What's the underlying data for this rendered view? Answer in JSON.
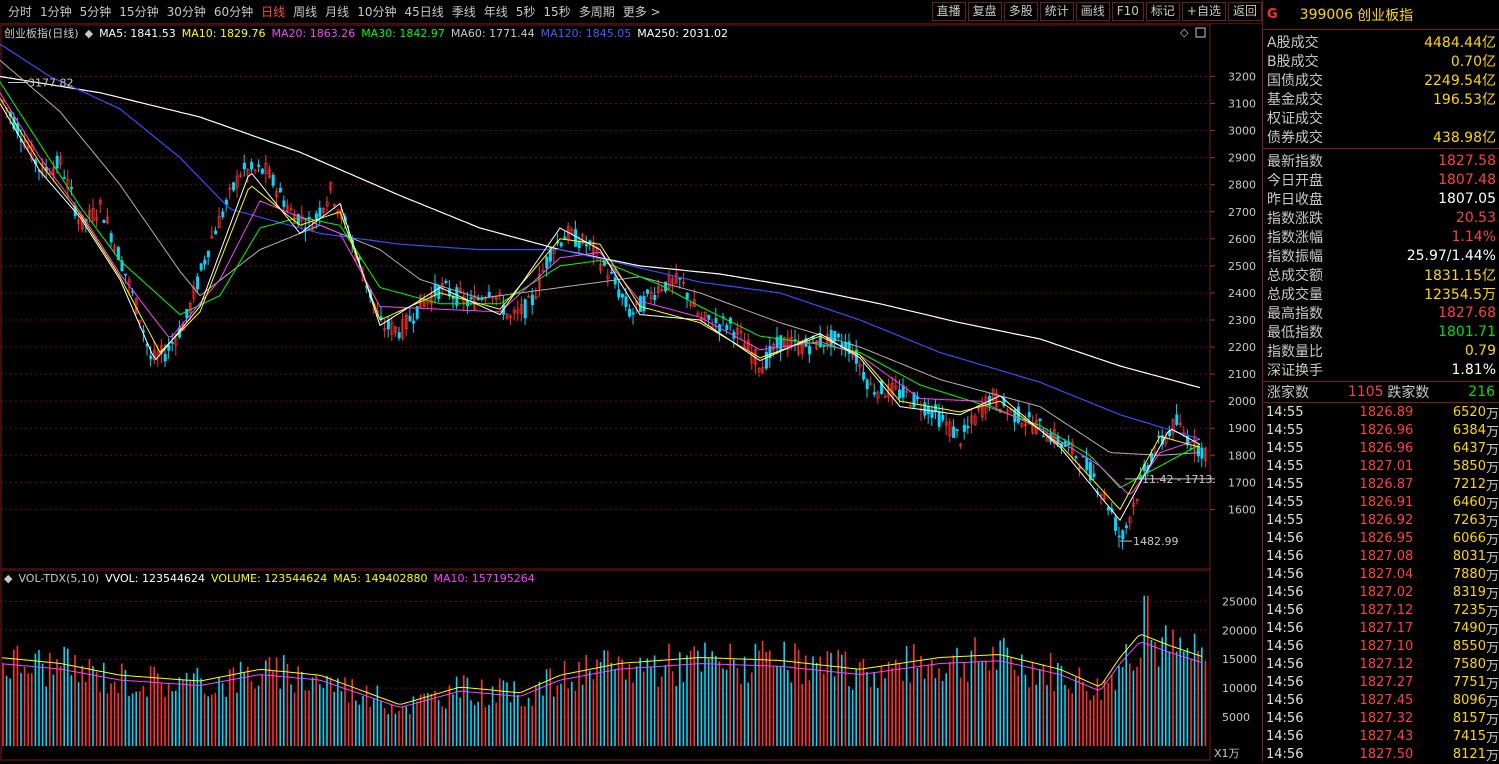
{
  "toolbar": {
    "periods": [
      "分时",
      "1分钟",
      "5分钟",
      "15分钟",
      "30分钟",
      "60分钟",
      "日线",
      "周线",
      "月线",
      "10分钟",
      "45日线",
      "季线",
      "年线",
      "5秒",
      "15秒",
      "多周期",
      "更多 >"
    ],
    "active_period": "日线",
    "tools": [
      "直播",
      "复盘",
      "多股",
      "统计",
      "画线",
      "F10",
      "标记",
      "+自选",
      "返回"
    ]
  },
  "main": {
    "title": "创业板指(日线)",
    "ma": [
      {
        "label": "MA5: 1841.53",
        "color": "#ffffff"
      },
      {
        "label": "MA10: 1829.76",
        "color": "#ffff00"
      },
      {
        "label": "MA20: 1863.26",
        "color": "#ff40ff"
      },
      {
        "label": "MA30: 1842.97",
        "color": "#00ff00"
      },
      {
        "label": "MA60: 1771.44",
        "color": "#c8c8c8"
      },
      {
        "label": "MA120: 1845.05",
        "color": "#4060ff"
      },
      {
        "label": "MA250: 2031.02",
        "color": "#ffffff"
      }
    ],
    "y_labels": [
      "3200",
      "3100",
      "3000",
      "2900",
      "2800",
      "2700",
      "2600",
      "2500",
      "2400",
      "2300",
      "2200",
      "2100",
      "2000",
      "1900",
      "1800",
      "1700",
      "1600"
    ],
    "annot_high": "3177.82",
    "annot_low": "1482.99",
    "annot_range": "11.42 - 1713."
  },
  "volume": {
    "title": "VOL-TDX(5,10)",
    "items": [
      {
        "label": "VVOL: 123544624",
        "color": "#ffffff"
      },
      {
        "label": "VOLUME: 123544624",
        "color": "#ffff00"
      },
      {
        "label": "MA5: 149402880",
        "color": "#ffff00"
      },
      {
        "label": "MA10: 157195264",
        "color": "#ff40ff"
      }
    ],
    "y_labels": [
      "25000",
      "20000",
      "15000",
      "10000",
      "5000"
    ],
    "unit": "X1万"
  },
  "panel": {
    "flag": "G",
    "code": "399006",
    "name": "创业板指",
    "turnover": [
      {
        "l": "A股成交",
        "v": "4484.44",
        "u": "亿"
      },
      {
        "l": "B股成交",
        "v": "0.70",
        "u": "亿"
      },
      {
        "l": "国债成交",
        "v": "2249.54",
        "u": "亿"
      },
      {
        "l": "基金成交",
        "v": "196.53",
        "u": "亿"
      },
      {
        "l": "权证成交",
        "v": "",
        "u": ""
      },
      {
        "l": "债券成交",
        "v": "438.98",
        "u": "亿"
      }
    ],
    "stats": [
      {
        "l": "最新指数",
        "v": "1827.58",
        "c": "rd"
      },
      {
        "l": "今日开盘",
        "v": "1807.48",
        "c": "rd"
      },
      {
        "l": "昨日收盘",
        "v": "1807.05",
        "c": "wh"
      },
      {
        "l": "指数涨跌",
        "v": "20.53",
        "c": "rd"
      },
      {
        "l": "指数涨幅",
        "v": "1.14%",
        "c": "rd"
      },
      {
        "l": "指数振幅",
        "v": "25.97/1.44%",
        "c": "wh"
      },
      {
        "l": "总成交额",
        "v": "1831.15亿",
        "c": "yl"
      },
      {
        "l": "总成交量",
        "v": "12354.5万",
        "c": "yl"
      },
      {
        "l": "最高指数",
        "v": "1827.68",
        "c": "rd"
      },
      {
        "l": "最低指数",
        "v": "1801.71",
        "c": "gr"
      },
      {
        "l": "指数量比",
        "v": "0.79",
        "c": "yl"
      },
      {
        "l": "深证换手",
        "v": "1.81%",
        "c": "wh"
      }
    ],
    "adv_label": "涨家数",
    "adv": "1105",
    "dec_label": "跌家数",
    "dec": "216",
    "ticks": [
      {
        "t": "14:55",
        "p": "1826.89",
        "v": "6520"
      },
      {
        "t": "14:55",
        "p": "1826.96",
        "v": "6384"
      },
      {
        "t": "14:55",
        "p": "1826.96",
        "v": "6437"
      },
      {
        "t": "14:55",
        "p": "1827.01",
        "v": "5850"
      },
      {
        "t": "14:55",
        "p": "1826.87",
        "v": "7212"
      },
      {
        "t": "14:55",
        "p": "1826.91",
        "v": "6460"
      },
      {
        "t": "14:55",
        "p": "1826.92",
        "v": "7263"
      },
      {
        "t": "14:56",
        "p": "1826.95",
        "v": "6066"
      },
      {
        "t": "14:56",
        "p": "1827.08",
        "v": "8031"
      },
      {
        "t": "14:56",
        "p": "1827.04",
        "v": "7880"
      },
      {
        "t": "14:56",
        "p": "1827.02",
        "v": "8319"
      },
      {
        "t": "14:56",
        "p": "1827.12",
        "v": "7235"
      },
      {
        "t": "14:56",
        "p": "1827.17",
        "v": "7490"
      },
      {
        "t": "14:56",
        "p": "1827.10",
        "v": "8550"
      },
      {
        "t": "14:56",
        "p": "1827.12",
        "v": "7580"
      },
      {
        "t": "14:56",
        "p": "1827.27",
        "v": "7751"
      },
      {
        "t": "14:56",
        "p": "1827.45",
        "v": "8096"
      },
      {
        "t": "14:56",
        "p": "1827.32",
        "v": "8157"
      },
      {
        "t": "14:56",
        "p": "1827.43",
        "v": "7415"
      },
      {
        "t": "14:56",
        "p": "1827.50",
        "v": "8121"
      }
    ],
    "tick_unit": "万"
  },
  "chart_data": {
    "type": "candlestick",
    "ylim": [
      1450,
      3320
    ],
    "ma_keypoints": {
      "MA250": [
        [
          0,
          3200
        ],
        [
          100,
          3140
        ],
        [
          200,
          3050
        ],
        [
          300,
          2920
        ],
        [
          400,
          2760
        ],
        [
          480,
          2640
        ],
        [
          560,
          2560
        ],
        [
          640,
          2500
        ],
        [
          720,
          2470
        ],
        [
          800,
          2420
        ],
        [
          880,
          2360
        ],
        [
          960,
          2290
        ],
        [
          1040,
          2230
        ],
        [
          1120,
          2130
        ],
        [
          1200,
          2050
        ]
      ],
      "MA120": [
        [
          0,
          3320
        ],
        [
          50,
          3200
        ],
        [
          120,
          3080
        ],
        [
          180,
          2900
        ],
        [
          230,
          2710
        ],
        [
          270,
          2670
        ],
        [
          320,
          2620
        ],
        [
          400,
          2580
        ],
        [
          480,
          2560
        ],
        [
          560,
          2560
        ],
        [
          620,
          2510
        ],
        [
          700,
          2440
        ],
        [
          780,
          2400
        ],
        [
          860,
          2300
        ],
        [
          940,
          2180
        ],
        [
          1040,
          2070
        ],
        [
          1120,
          1950
        ],
        [
          1200,
          1860
        ]
      ],
      "MA60": [
        [
          0,
          3260
        ],
        [
          60,
          3070
        ],
        [
          120,
          2800
        ],
        [
          180,
          2480
        ],
        [
          200,
          2390
        ],
        [
          260,
          2560
        ],
        [
          320,
          2650
        ],
        [
          380,
          2560
        ],
        [
          420,
          2450
        ],
        [
          480,
          2380
        ],
        [
          560,
          2420
        ],
        [
          640,
          2460
        ],
        [
          700,
          2400
        ],
        [
          780,
          2290
        ],
        [
          860,
          2200
        ],
        [
          940,
          2080
        ],
        [
          1040,
          1980
        ],
        [
          1110,
          1810
        ],
        [
          1160,
          1800
        ],
        [
          1200,
          1810
        ]
      ],
      "MA30": [
        [
          0,
          3180
        ],
        [
          40,
          2950
        ],
        [
          80,
          2720
        ],
        [
          120,
          2520
        ],
        [
          180,
          2320
        ],
        [
          220,
          2390
        ],
        [
          260,
          2640
        ],
        [
          300,
          2680
        ],
        [
          340,
          2650
        ],
        [
          380,
          2420
        ],
        [
          440,
          2360
        ],
        [
          500,
          2360
        ],
        [
          560,
          2500
        ],
        [
          600,
          2520
        ],
        [
          660,
          2430
        ],
        [
          700,
          2350
        ],
        [
          760,
          2240
        ],
        [
          820,
          2210
        ],
        [
          860,
          2180
        ],
        [
          920,
          2060
        ],
        [
          980,
          1990
        ],
        [
          1040,
          1910
        ],
        [
          1090,
          1800
        ],
        [
          1120,
          1680
        ],
        [
          1160,
          1760
        ],
        [
          1200,
          1840
        ]
      ],
      "MA20": [
        [
          0,
          3140
        ],
        [
          40,
          2900
        ],
        [
          80,
          2700
        ],
        [
          120,
          2470
        ],
        [
          170,
          2230
        ],
        [
          220,
          2450
        ],
        [
          260,
          2740
        ],
        [
          300,
          2680
        ],
        [
          340,
          2620
        ],
        [
          380,
          2350
        ],
        [
          440,
          2340
        ],
        [
          500,
          2330
        ],
        [
          560,
          2530
        ],
        [
          600,
          2550
        ],
        [
          640,
          2370
        ],
        [
          700,
          2310
        ],
        [
          760,
          2190
        ],
        [
          820,
          2220
        ],
        [
          860,
          2170
        ],
        [
          920,
          2010
        ],
        [
          980,
          2000
        ],
        [
          1040,
          1900
        ],
        [
          1100,
          1760
        ],
        [
          1130,
          1650
        ],
        [
          1160,
          1810
        ],
        [
          1200,
          1860
        ]
      ],
      "MA10": [
        [
          0,
          3120
        ],
        [
          40,
          2880
        ],
        [
          80,
          2690
        ],
        [
          120,
          2460
        ],
        [
          160,
          2180
        ],
        [
          200,
          2330
        ],
        [
          250,
          2800
        ],
        [
          300,
          2650
        ],
        [
          340,
          2700
        ],
        [
          380,
          2300
        ],
        [
          440,
          2400
        ],
        [
          500,
          2340
        ],
        [
          560,
          2600
        ],
        [
          600,
          2580
        ],
        [
          640,
          2350
        ],
        [
          700,
          2290
        ],
        [
          760,
          2160
        ],
        [
          820,
          2240
        ],
        [
          860,
          2170
        ],
        [
          900,
          2000
        ],
        [
          960,
          1960
        ],
        [
          1000,
          2000
        ],
        [
          1060,
          1840
        ],
        [
          1120,
          1600
        ],
        [
          1160,
          1870
        ],
        [
          1200,
          1830
        ]
      ],
      "MA5": [
        [
          0,
          3100
        ],
        [
          40,
          2850
        ],
        [
          80,
          2680
        ],
        [
          120,
          2450
        ],
        [
          155,
          2150
        ],
        [
          200,
          2350
        ],
        [
          250,
          2850
        ],
        [
          300,
          2620
        ],
        [
          340,
          2730
        ],
        [
          380,
          2280
        ],
        [
          440,
          2420
        ],
        [
          500,
          2320
        ],
        [
          560,
          2640
        ],
        [
          600,
          2560
        ],
        [
          640,
          2320
        ],
        [
          700,
          2300
        ],
        [
          760,
          2150
        ],
        [
          820,
          2250
        ],
        [
          860,
          2160
        ],
        [
          900,
          1980
        ],
        [
          960,
          1950
        ],
        [
          1000,
          2020
        ],
        [
          1060,
          1830
        ],
        [
          1120,
          1560
        ],
        [
          1170,
          1900
        ],
        [
          1200,
          1840
        ]
      ]
    },
    "price_path": [
      [
        0,
        3120
      ],
      [
        20,
        2990
      ],
      [
        40,
        2850
      ],
      [
        60,
        2880
      ],
      [
        80,
        2650
      ],
      [
        100,
        2720
      ],
      [
        120,
        2520
      ],
      [
        140,
        2300
      ],
      [
        150,
        2150
      ],
      [
        165,
        2180
      ],
      [
        185,
        2300
      ],
      [
        210,
        2600
      ],
      [
        240,
        2850
      ],
      [
        265,
        2850
      ],
      [
        290,
        2700
      ],
      [
        310,
        2650
      ],
      [
        330,
        2780
      ],
      [
        350,
        2600
      ],
      [
        380,
        2280
      ],
      [
        400,
        2260
      ],
      [
        420,
        2360
      ],
      [
        440,
        2420
      ],
      [
        470,
        2360
      ],
      [
        490,
        2420
      ],
      [
        510,
        2300
      ],
      [
        530,
        2360
      ],
      [
        550,
        2560
      ],
      [
        565,
        2620
      ],
      [
        590,
        2570
      ],
      [
        610,
        2460
      ],
      [
        630,
        2320
      ],
      [
        660,
        2430
      ],
      [
        680,
        2440
      ],
      [
        700,
        2300
      ],
      [
        730,
        2280
      ],
      [
        760,
        2130
      ],
      [
        780,
        2220
      ],
      [
        800,
        2200
      ],
      [
        830,
        2230
      ],
      [
        850,
        2200
      ],
      [
        870,
        2050
      ],
      [
        900,
        2030
      ],
      [
        930,
        1970
      ],
      [
        960,
        1860
      ],
      [
        990,
        2020
      ],
      [
        1010,
        1960
      ],
      [
        1040,
        1900
      ],
      [
        1070,
        1820
      ],
      [
        1090,
        1740
      ],
      [
        1110,
        1600
      ],
      [
        1120,
        1482
      ],
      [
        1135,
        1650
      ],
      [
        1150,
        1800
      ],
      [
        1175,
        1920
      ],
      [
        1190,
        1850
      ],
      [
        1205,
        1810
      ]
    ]
  }
}
